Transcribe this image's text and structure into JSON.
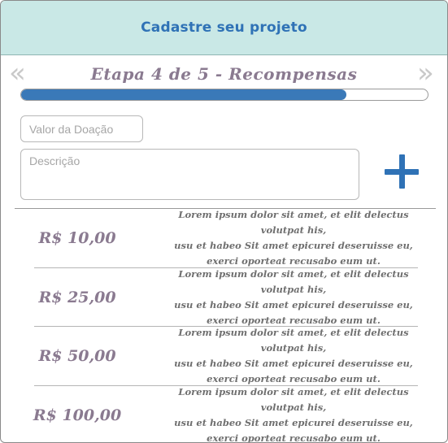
{
  "header": {
    "title": "Cadastre seu projeto"
  },
  "navigation": {
    "prev_glyph": "«",
    "next_glyph": "»"
  },
  "step": {
    "title": "Etapa 4 de 5 - Recompensas",
    "progress_fraction": 0.8
  },
  "form": {
    "value_placeholder": "Valor da Doação",
    "description_placeholder": "Descrição",
    "add_icon": "plus-icon"
  },
  "rewards": [
    {
      "amount": "R$ 10,00",
      "lines": [
        "Lorem ipsum dolor sit amet, et elit delectus volutpat his,",
        "usu et habeo Sit amet epicurei deseruisse eu,",
        "exerci oporteat recusabo eum ut."
      ]
    },
    {
      "amount": "R$ 25,00",
      "lines": [
        "Lorem ipsum dolor sit amet, et elit delectus volutpat his,",
        "usu et habeo Sit amet epicurei deseruisse eu,",
        "exerci oporteat recusabo eum ut."
      ]
    },
    {
      "amount": "R$ 50,00",
      "lines": [
        "Lorem ipsum dolor sit amet, et elit delectus volutpat his,",
        "usu et habeo Sit amet epicurei deseruisse eu,",
        "exerci oporteat recusabo eum ut."
      ]
    },
    {
      "amount": "R$ 100,00",
      "lines": [
        "Lorem ipsum dolor sit amet, et elit delectus volutpat his,",
        "usu et habeo Sit amet epicurei deseruisse eu,",
        "exerci oporteat recusabo eum ut."
      ]
    }
  ],
  "colors": {
    "header_bg": "#c9e8e6",
    "accent": "#2f72b6",
    "progress": "#3a79b8",
    "muted_purple": "#8a7a90"
  }
}
